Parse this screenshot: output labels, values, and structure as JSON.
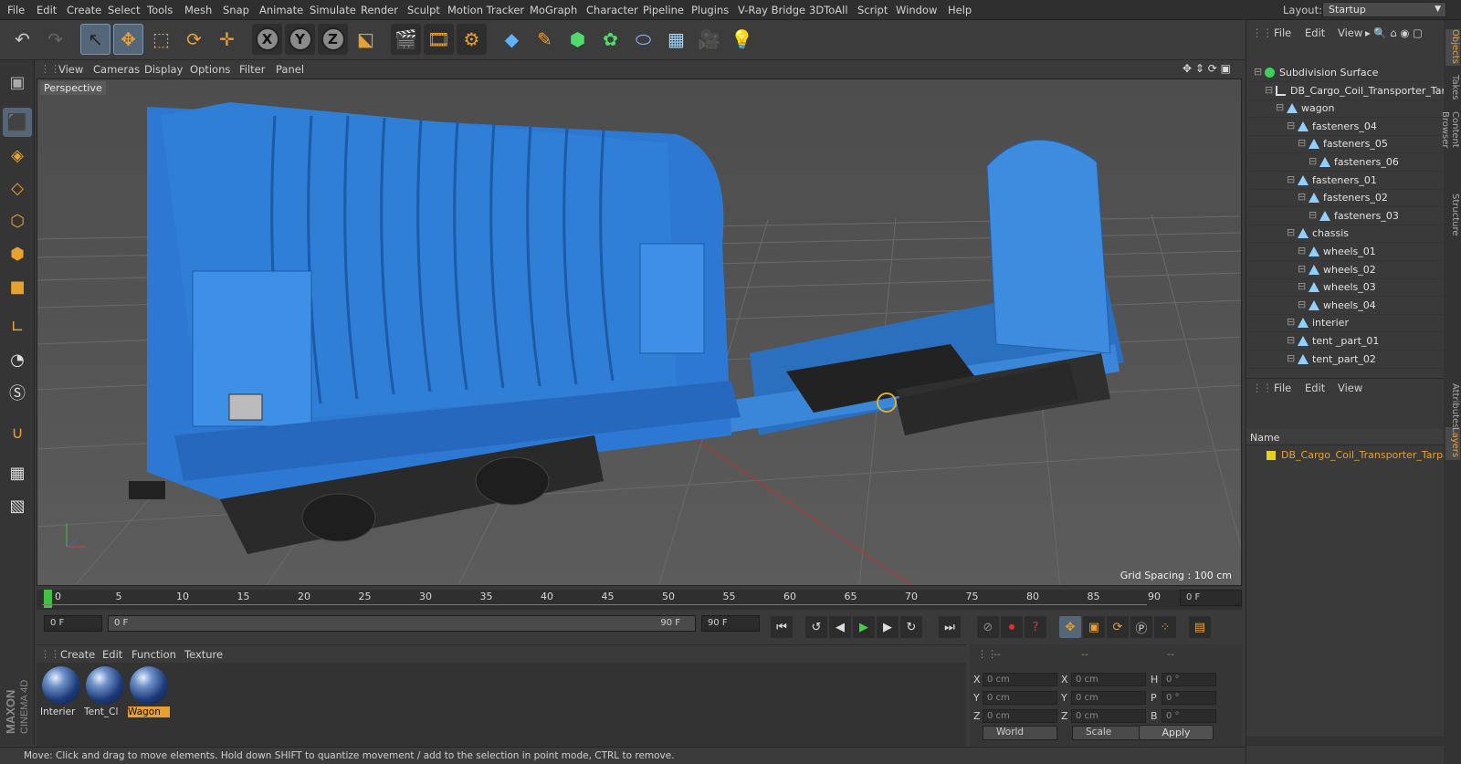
{
  "menu": [
    "File",
    "Edit",
    "Create",
    "Select",
    "Tools",
    "Mesh",
    "Snap",
    "Animate",
    "Simulate",
    "Render",
    "Sculpt",
    "Motion Tracker",
    "MoGraph",
    "Character",
    "Pipeline",
    "Plugins",
    "V-Ray Bridge",
    "3DToAll",
    "Script",
    "Window",
    "Help"
  ],
  "layout": {
    "label": "Layout:",
    "value": "Startup"
  },
  "toolbar_icons": [
    "undo-icon",
    "redo-icon",
    "live-select-icon",
    "move-icon",
    "scale-icon",
    "rotate-icon",
    "recent-tool-icon",
    "x-axis-icon",
    "y-axis-icon",
    "z-axis-icon",
    "world-coordinates-icon",
    "render-view-icon",
    "render-picture-viewer-icon",
    "render-settings-icon",
    "cube-icon",
    "pen-spline-icon",
    "subdivision-icon",
    "cloner-icon",
    "deformer-icon",
    "floor-icon",
    "camera-icon",
    "light-icon"
  ],
  "toolbar_axis_labels": [
    "X",
    "Y",
    "Z"
  ],
  "left_toolbar_icons": [
    "make-editable-icon",
    "model-mode-icon",
    "texture-mode-icon",
    "workplane-icon",
    "points-mode-icon",
    "edges-mode-icon",
    "polygons-mode-icon",
    "axis-mode-icon",
    "tweak-mode-icon",
    "snap-icon",
    "magnet-icon",
    "lock-workplane-icon",
    "grid-icon"
  ],
  "viewport": {
    "menu": [
      "View",
      "Cameras",
      "Display",
      "Options",
      "Filter",
      "Panel"
    ],
    "label": "Perspective",
    "grid_spacing": "Grid Spacing : 100 cm"
  },
  "timeline": {
    "ticks": [
      "0",
      "5",
      "10",
      "15",
      "20",
      "25",
      "30",
      "35",
      "40",
      "45",
      "50",
      "55",
      "60",
      "65",
      "70",
      "75",
      "80",
      "85",
      "90"
    ],
    "current_frame": "0 F",
    "end_frame_field": "0 F"
  },
  "playbar": {
    "start": "0 F",
    "slider_left": "0 F",
    "slider_right": "90 F",
    "end": "90 F"
  },
  "materials": {
    "menu": [
      "Create",
      "Edit",
      "Function",
      "Texture"
    ],
    "items": [
      {
        "name": "Interier",
        "selected": false
      },
      {
        "name": "Tent_Cl",
        "selected": false
      },
      {
        "name": "Wagon",
        "selected": true
      }
    ]
  },
  "coords": {
    "col1_labels": [
      "X",
      "Y",
      "Z"
    ],
    "col2_labels": [
      "X",
      "Y",
      "Z"
    ],
    "col3_labels": [
      "H",
      "P",
      "B"
    ],
    "col1_values": [
      "0 cm",
      "0 cm",
      "0 cm"
    ],
    "col2_values": [
      "0 cm",
      "0 cm",
      "0 cm"
    ],
    "col3_values": [
      "0 °",
      "0 °",
      "0 °"
    ],
    "header_dashes": [
      "--",
      "--",
      "--"
    ],
    "world": "World",
    "scale": "Scale",
    "apply": "Apply"
  },
  "status": "Move: Click and drag to move elements. Hold down SHIFT to quantize movement / add to the selection in point mode, CTRL to remove.",
  "objects_panel": {
    "menu": [
      "File",
      "Edit",
      "View"
    ],
    "tree": [
      {
        "label": "Subdivision Surface",
        "indent": 0,
        "icon": "subdivision-icon"
      },
      {
        "label": "DB_Cargo_Coil_Transporter_Tarp",
        "indent": 1,
        "icon": "null-icon"
      },
      {
        "label": "wagon",
        "indent": 2,
        "icon": "polygon-icon"
      },
      {
        "label": "fasteners_04",
        "indent": 3,
        "icon": "polygon-icon"
      },
      {
        "label": "fasteners_05",
        "indent": 4,
        "icon": "polygon-icon"
      },
      {
        "label": "fasteners_06",
        "indent": 5,
        "icon": "polygon-icon"
      },
      {
        "label": "fasteners_01",
        "indent": 3,
        "icon": "polygon-icon"
      },
      {
        "label": "fasteners_02",
        "indent": 4,
        "icon": "polygon-icon"
      },
      {
        "label": "fasteners_03",
        "indent": 5,
        "icon": "polygon-icon"
      },
      {
        "label": "chassis",
        "indent": 3,
        "icon": "polygon-icon"
      },
      {
        "label": "wheels_01",
        "indent": 4,
        "icon": "polygon-icon"
      },
      {
        "label": "wheels_02",
        "indent": 4,
        "icon": "polygon-icon"
      },
      {
        "label": "wheels_03",
        "indent": 4,
        "icon": "polygon-icon"
      },
      {
        "label": "wheels_04",
        "indent": 4,
        "icon": "polygon-icon"
      },
      {
        "label": "interier",
        "indent": 3,
        "icon": "polygon-icon"
      },
      {
        "label": "tent _part_01",
        "indent": 3,
        "icon": "polygon-icon"
      },
      {
        "label": "tent_part_02",
        "indent": 3,
        "icon": "polygon-icon"
      }
    ]
  },
  "layers_panel": {
    "menu": [
      "File",
      "Edit",
      "View"
    ],
    "header": "Name",
    "layer": "DB_Cargo_Coil_Transporter_Tarpa"
  },
  "side_tabs": [
    "Objects",
    "Takes",
    "Content Browser",
    "Structure",
    "Attributes",
    "Layers"
  ],
  "branding": {
    "maxon": "MAXON",
    "product": "CINEMA 4D"
  },
  "colors": {
    "accent": "#e8a030",
    "wagon_blue": "#2f7fd6",
    "selection": "#556678"
  }
}
